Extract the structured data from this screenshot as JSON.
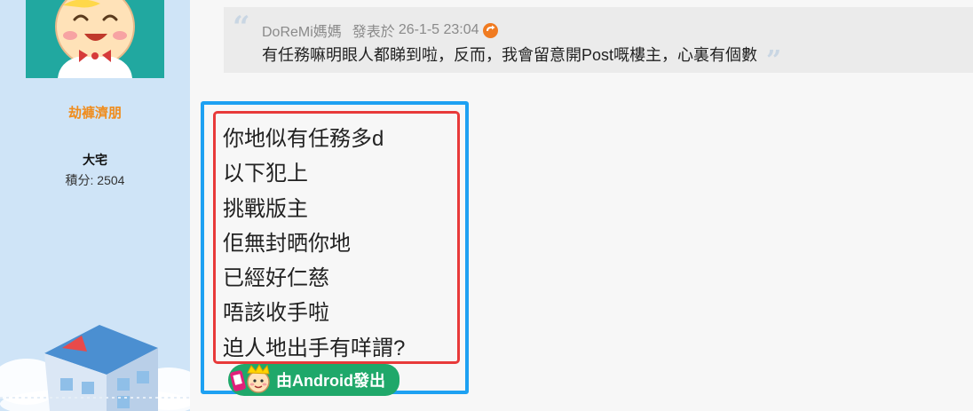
{
  "sidebar": {
    "username": "劫褲濟朋",
    "rank": "大宅",
    "points": "積分: 2504"
  },
  "quote": {
    "author": "DoReMi媽媽",
    "posted_label": "發表於",
    "date": "26-1-5 23:04",
    "text": "有任務嘛明眼人都睇到啦，反而，我會留意開Post嘅樓主，心裏有個數"
  },
  "post": {
    "lines": [
      "你地似有任務多d",
      "以下犯上",
      "挑戰版主",
      "佢無封晒你地",
      "已經好仁慈",
      "唔該收手啦",
      "迫人地出手有咩謂?"
    ]
  },
  "badge": {
    "label": "由Android發出"
  },
  "colors": {
    "sidebar_bg": "#cfe4f7",
    "username": "#f08c1c",
    "blue_frame": "#1da1f2",
    "red_frame": "#e83a3a",
    "badge_bg": "#1fa86a"
  },
  "icons": [
    "baby-avatar-icon",
    "quote-open-icon",
    "jump-to-post-icon",
    "quote-close-icon",
    "house-icon",
    "android-mascot-icon"
  ]
}
